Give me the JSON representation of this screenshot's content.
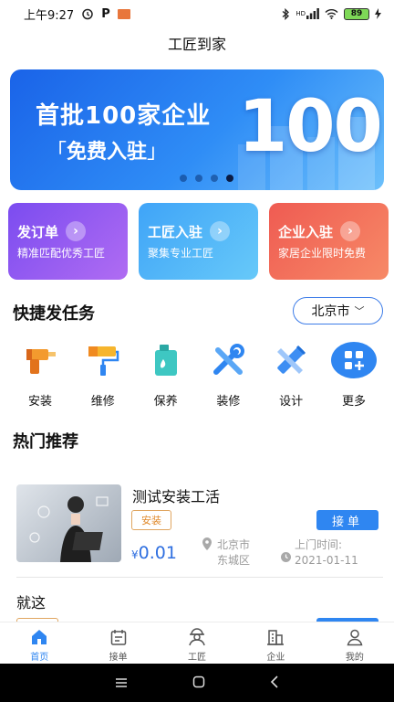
{
  "status": {
    "time": "上午9:27",
    "carrier_icon_letter": "P",
    "network": "HD",
    "battery": "89"
  },
  "app": {
    "title": "工匠到家"
  },
  "banner": {
    "headline": "首批100家企业",
    "subline": "免费入驻",
    "bracket_left": "「",
    "bracket_right": "」",
    "big_number": "100",
    "page_count": 4,
    "active_index": 3
  },
  "cards": [
    {
      "title": "发订单",
      "subtitle": "精准匹配优秀工匠",
      "arrow": "›"
    },
    {
      "title": "工匠入驻",
      "subtitle": "聚集专业工匠",
      "arrow": "›"
    },
    {
      "title": "企业入驻",
      "subtitle": "家居企业限时免费",
      "arrow": "›"
    }
  ],
  "quick": {
    "title": "快捷发任务",
    "city": "北京市",
    "city_chevron": "﹀",
    "items": [
      {
        "label": "安装",
        "icon": "drill-icon"
      },
      {
        "label": "维修",
        "icon": "paint-roller-icon"
      },
      {
        "label": "保养",
        "icon": "oil-can-icon"
      },
      {
        "label": "装修",
        "icon": "tools-icon"
      },
      {
        "label": "设计",
        "icon": "ruler-pencil-icon"
      },
      {
        "label": "更多",
        "icon": "grid-plus-icon"
      }
    ]
  },
  "hot": {
    "title": "热门推荐",
    "items": [
      {
        "name": "测试安装工活",
        "tag": "安装",
        "currency": "¥",
        "price": "0.01",
        "location_line1": "北京市",
        "location_line2": "东城区",
        "time_label": "上门时间:",
        "time_value": "2021-01-11",
        "action": "接单"
      },
      {
        "name": "就这"
      }
    ]
  },
  "tabs": [
    {
      "label": "首页",
      "icon": "home-icon",
      "active": true
    },
    {
      "label": "接单",
      "icon": "calendar-icon",
      "active": false
    },
    {
      "label": "工匠",
      "icon": "worker-icon",
      "active": false
    },
    {
      "label": "企业",
      "icon": "building-icon",
      "active": false
    },
    {
      "label": "我的",
      "icon": "user-icon",
      "active": false
    }
  ],
  "colors": {
    "accent": "#2f86f1",
    "tag": "#e08a2c",
    "price": "#2f6fe0"
  }
}
